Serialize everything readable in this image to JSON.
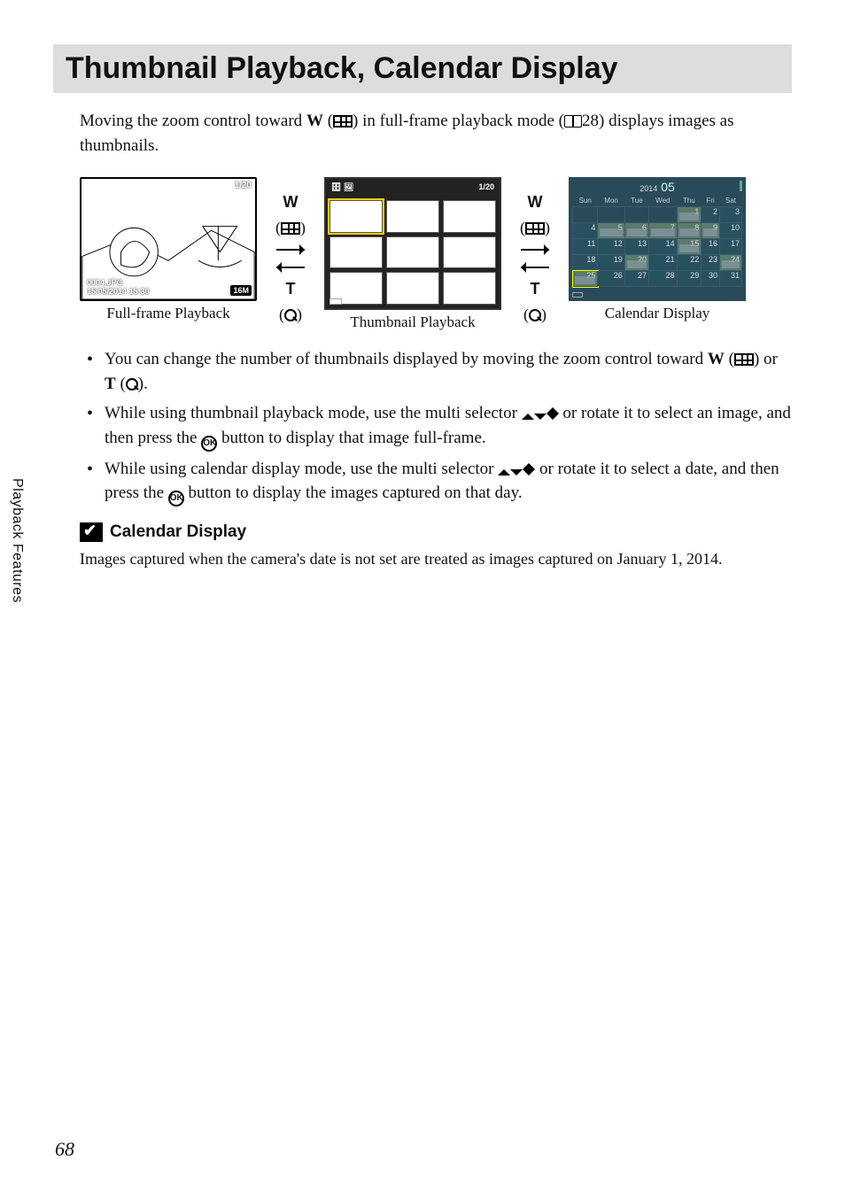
{
  "side_tab": "Playback Features",
  "title": "Thumbnail Playback, Calendar Display",
  "intro": {
    "a": "Moving the zoom control toward ",
    "w": "W",
    "b": " (",
    "c": ") in full-frame playback mode (",
    "pref": "28) displays images as thumbnails."
  },
  "figs": {
    "full": "Full-frame Playback",
    "thumb": "Thumbnail Playback",
    "cal": "Calendar Display",
    "counter_full": "1/20",
    "counter_thumb": "1/20",
    "info1": "0004.JPG",
    "info2": "15/05/2014 15:30",
    "badge": "16M"
  },
  "trans": {
    "w": "W",
    "t": "T"
  },
  "calendar": {
    "year": "2014",
    "month": "05",
    "days": [
      "Sun",
      "Mon",
      "Tue",
      "Wed",
      "Thu",
      "Fri",
      "Sat"
    ],
    "rows": [
      [
        {
          "n": "",
          "t": ""
        },
        {
          "n": "",
          "t": ""
        },
        {
          "n": "",
          "t": ""
        },
        {
          "n": "",
          "t": ""
        },
        {
          "n": "1",
          "t": "pic"
        },
        {
          "n": "2",
          "t": "dark"
        },
        {
          "n": "3",
          "t": "dark"
        }
      ],
      [
        {
          "n": "4",
          "t": "dark"
        },
        {
          "n": "5",
          "t": "pic"
        },
        {
          "n": "6",
          "t": "pic"
        },
        {
          "n": "7",
          "t": "pic"
        },
        {
          "n": "8",
          "t": "pic"
        },
        {
          "n": "9",
          "t": "pic"
        },
        {
          "n": "10",
          "t": "dark"
        }
      ],
      [
        {
          "n": "11",
          "t": "dark"
        },
        {
          "n": "12",
          "t": "dark"
        },
        {
          "n": "13",
          "t": "dark"
        },
        {
          "n": "14",
          "t": "dark"
        },
        {
          "n": "15",
          "t": "pic"
        },
        {
          "n": "16",
          "t": "dark"
        },
        {
          "n": "17",
          "t": "dark"
        }
      ],
      [
        {
          "n": "18",
          "t": "dark"
        },
        {
          "n": "19",
          "t": "dark"
        },
        {
          "n": "20",
          "t": "pic"
        },
        {
          "n": "21",
          "t": "dark"
        },
        {
          "n": "22",
          "t": "dark"
        },
        {
          "n": "23",
          "t": "dark"
        },
        {
          "n": "24",
          "t": "pic"
        }
      ],
      [
        {
          "n": "25",
          "t": "pic sel"
        },
        {
          "n": "26",
          "t": "dark"
        },
        {
          "n": "27",
          "t": "dark"
        },
        {
          "n": "28",
          "t": "dark"
        },
        {
          "n": "29",
          "t": "dark"
        },
        {
          "n": "30",
          "t": "dark"
        },
        {
          "n": "31",
          "t": "dark"
        }
      ]
    ]
  },
  "bullets": {
    "b1a": "You can change the number of thumbnails displayed by moving the zoom control toward ",
    "b1w": "W",
    "b1mid": " (",
    "b1or": ") or ",
    "b1t": "T",
    "b1end": " (",
    "b1close": ").",
    "b2a": "While using thumbnail playback mode, use the multi selector ",
    "b2b": " or rotate it to select an image, and then press the ",
    "b2c": " button to display that image full-frame.",
    "b3a": "While using calendar display mode, use the multi selector ",
    "b3b": " or rotate it to select a date, and then press the ",
    "b3c": " button to display the images captured on that day."
  },
  "note": {
    "title": "Calendar Display",
    "body": "Images captured when the camera's date is not set are treated as images captured on January 1, 2014."
  },
  "ok_label": "OK",
  "page_number": "68"
}
